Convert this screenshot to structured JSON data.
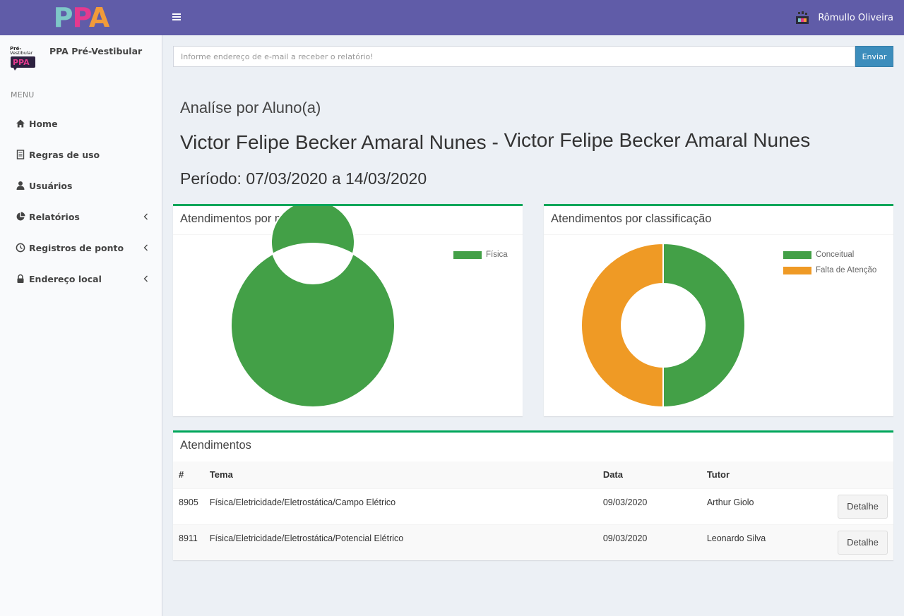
{
  "header": {
    "logo": {
      "p1": "P",
      "p2": "P",
      "a": "A"
    },
    "user_name": "Rômullo Oliveira"
  },
  "sidebar": {
    "brand_name": "PPA Pré-Vestibular",
    "brand_logo_text": {
      "top": "Pré-",
      "mid": "Vestibular",
      "bottom": "PPA"
    },
    "menu_header": "MENU",
    "items": [
      {
        "label": "Home",
        "icon": "home-icon"
      },
      {
        "label": "Regras de uso",
        "icon": "document-icon"
      },
      {
        "label": "Usuários",
        "icon": "user-icon"
      },
      {
        "label": "Relatórios",
        "icon": "pie-chart-icon",
        "submenu": true
      },
      {
        "label": "Registros de ponto",
        "icon": "clock-icon",
        "submenu": true
      },
      {
        "label": "Endereço local",
        "icon": "lock-icon",
        "submenu": true
      }
    ]
  },
  "email": {
    "placeholder": "Informe endereço de e-mail a receber o relatório!",
    "send_label": "Enviar"
  },
  "content": {
    "analise_title": "Analíse por Aluno(a)",
    "student_name_a": "Victor Felipe Becker Amaral Nunes",
    "separator": "-",
    "student_name_b": "Victor Felipe Becker Amaral Nunes",
    "periodo": "Período: 07/03/2020 a 14/03/2020"
  },
  "colors": {
    "header": "#605ca8",
    "green": "#43a047",
    "orange": "#ef9a25",
    "box_border": "#00a65a",
    "button_blue": "#3c8dbc"
  },
  "chart_data": [
    {
      "type": "pie",
      "title": "Atendimentos por matéria",
      "labels": [
        "Física"
      ],
      "values": [
        2
      ],
      "colors": [
        "#43a047"
      ],
      "legend": "top-right"
    },
    {
      "type": "pie",
      "title": "Atendimentos por classificação",
      "labels": [
        "Conceitual",
        "Falta de Atenção"
      ],
      "values": [
        1,
        1
      ],
      "colors": [
        "#43a047",
        "#ef9a25"
      ],
      "legend": "top-right"
    }
  ],
  "atendimentos": {
    "title": "Atendimentos",
    "columns": [
      "#",
      "Tema",
      "Data",
      "Tutor",
      ""
    ],
    "rows": [
      {
        "id": "8905",
        "tema": "Física/Eletricidade/Eletrostática/Campo Elétrico",
        "data": "09/03/2020",
        "tutor": "Arthur Giolo",
        "action": "Detalhe"
      },
      {
        "id": "8911",
        "tema": "Física/Eletricidade/Eletrostática/Potencial Elétrico",
        "data": "09/03/2020",
        "tutor": "Leonardo Silva",
        "action": "Detalhe"
      }
    ]
  }
}
